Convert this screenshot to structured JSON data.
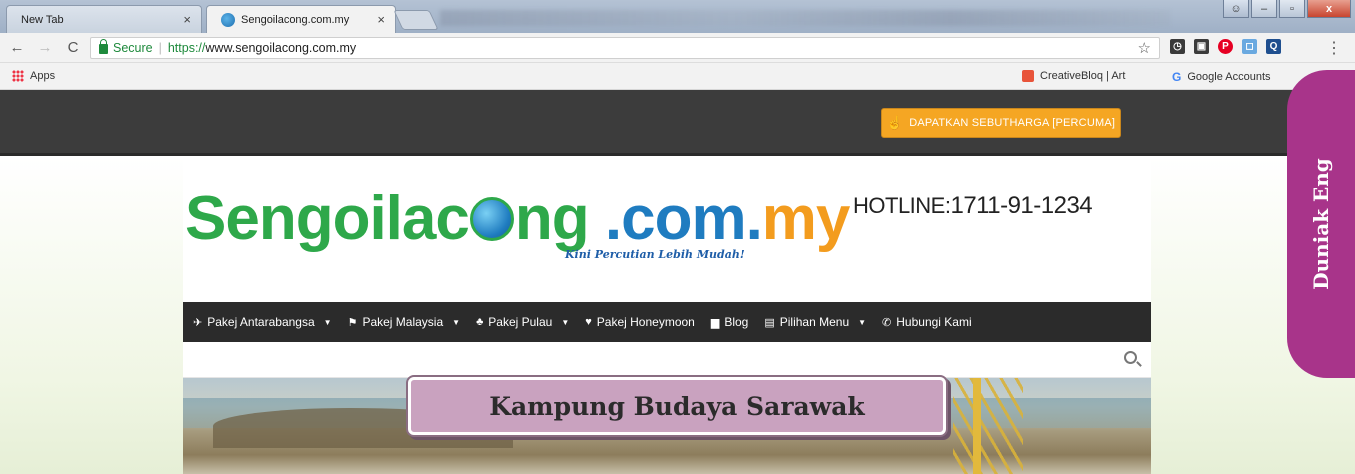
{
  "browser": {
    "tabs": [
      {
        "title": "New Tab",
        "active": false
      },
      {
        "title": "Sengoilacong.com.my",
        "active": true
      }
    ],
    "tab_close_glyph": "×",
    "window_controls": [
      "user-icon",
      "minimize-icon",
      "maximize-icon",
      "close-icon"
    ],
    "toolbar": {
      "back": "←",
      "forward": "→",
      "reload": "C",
      "secure_label": "Secure",
      "url_scheme": "https://",
      "url_rest": "www.sengoilacong.com.my",
      "star": "☆",
      "menu": "⋮"
    },
    "bookmarks": {
      "apps_label": "Apps",
      "items": [
        {
          "label": "CreativeBloq | Art",
          "icon": "creativebloq-icon"
        },
        {
          "label": "Google Accounts",
          "icon": "google-icon"
        }
      ]
    }
  },
  "site": {
    "quote_button": "DAPATKAN SEBUTHARGA [PERCUMA]",
    "logo": {
      "part1": "Sengoilac",
      "part2": "ng",
      "part3": ".com.",
      "part4": "my"
    },
    "tagline": "Kini Percutian Lebih Mudah!",
    "hotline_label": "HOTLINE:",
    "hotline_number": "1711-91-1234",
    "nav": [
      {
        "label": "Pakej Antarabangsa",
        "icon": "plane-icon",
        "glyph": "✈",
        "dropdown": true
      },
      {
        "label": "Pakej Malaysia",
        "icon": "flag-icon",
        "glyph": "⚑",
        "dropdown": true
      },
      {
        "label": "Pakej Pulau",
        "icon": "palm-icon",
        "glyph": "♣",
        "dropdown": true
      },
      {
        "label": "Pakej Honeymoon",
        "icon": "heart-icon",
        "glyph": "♥",
        "dropdown": false
      },
      {
        "label": "Blog",
        "icon": "blog-icon",
        "glyph": "▆",
        "dropdown": false
      },
      {
        "label": "Pilihan Menu",
        "icon": "list-icon",
        "glyph": "▤",
        "dropdown": true
      },
      {
        "label": "Hubungi Kami",
        "icon": "phone-icon",
        "glyph": "✆",
        "dropdown": false
      }
    ]
  },
  "overlay": {
    "caption": "Kampung Budaya Sarawak",
    "side_tab": "Duniak Eng"
  },
  "colors": {
    "logo_green": "#2ea84a",
    "logo_blue": "#1f7cc0",
    "logo_orange": "#f39c1e",
    "quote_button": "#f5a623",
    "side_tab": "#a8348a",
    "caption_bg": "#c9a2bf"
  }
}
